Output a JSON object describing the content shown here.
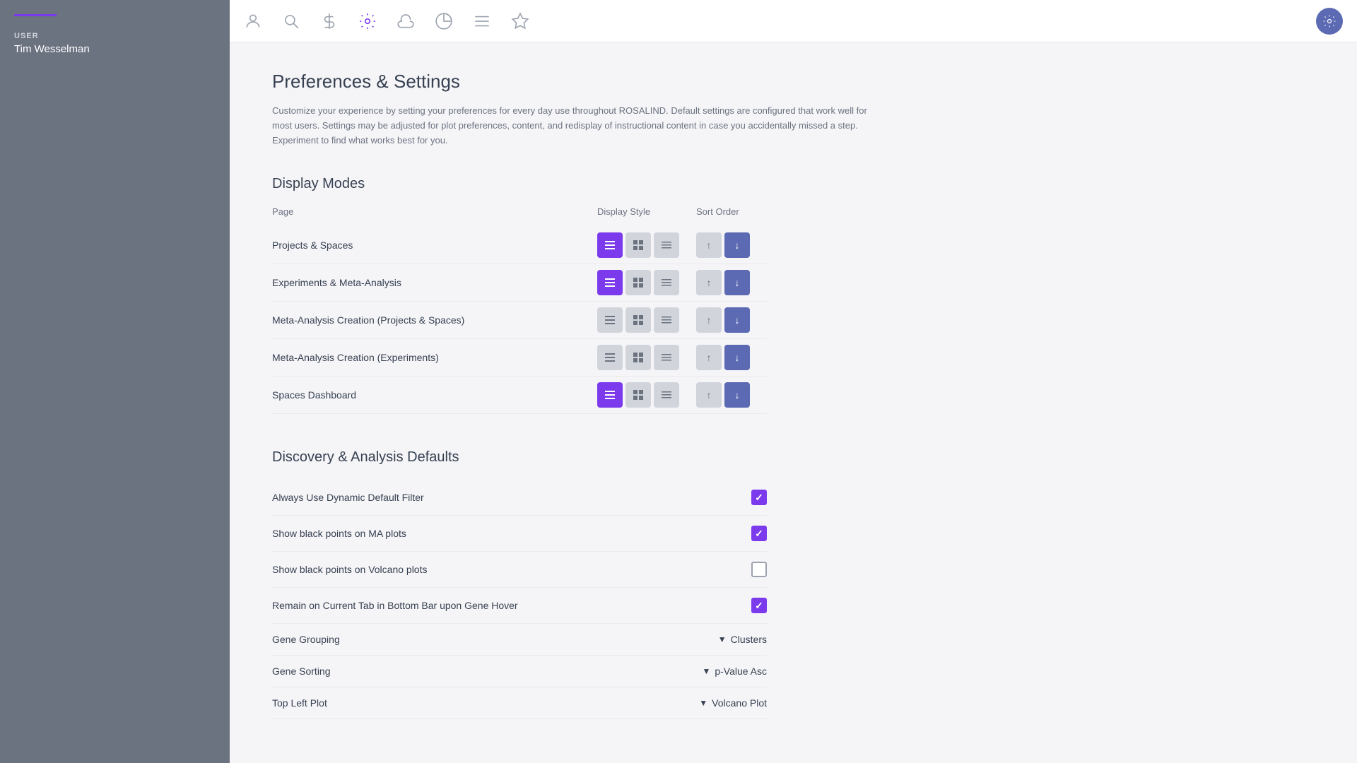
{
  "sidebar": {
    "user_label": "USER",
    "user_name": "Tim Wesselman"
  },
  "topbar": {
    "icons": [
      {
        "name": "person-icon",
        "symbol": "person",
        "active": false
      },
      {
        "name": "search-icon",
        "symbol": "search",
        "active": false
      },
      {
        "name": "dollar-icon",
        "symbol": "dollar",
        "active": false
      },
      {
        "name": "gear-icon",
        "symbol": "gear",
        "active": true
      },
      {
        "name": "cloud-icon",
        "symbol": "cloud",
        "active": false
      },
      {
        "name": "chart-icon",
        "symbol": "chart",
        "active": false
      },
      {
        "name": "list-icon",
        "symbol": "list",
        "active": false
      },
      {
        "name": "star-icon",
        "symbol": "star",
        "active": false
      }
    ]
  },
  "page": {
    "title": "Preferences & Settings",
    "description": "Customize your experience by setting your preferences for every day use throughout ROSALIND. Default settings are configured that work well for most users. Settings may be adjusted for plot preferences, content, and redisplay of instructional content in case you accidentally missed a step. Experiment to find what works best for you."
  },
  "display_modes": {
    "section_title": "Display Modes",
    "header_page": "Page",
    "header_display_style": "Display Style",
    "header_sort_order": "Sort Order",
    "rows": [
      {
        "label": "Projects & Spaces",
        "active_style": 0
      },
      {
        "label": "Experiments & Meta-Analysis",
        "active_style": 0
      },
      {
        "label": "Meta-Analysis Creation (Projects & Spaces)",
        "active_style": null
      },
      {
        "label": "Meta-Analysis Creation (Experiments)",
        "active_style": null
      },
      {
        "label": "Spaces Dashboard",
        "active_style": 0
      }
    ]
  },
  "defaults": {
    "section_title": "Discovery & Analysis Defaults",
    "rows": [
      {
        "label": "Always Use Dynamic Default Filter",
        "type": "checkbox",
        "checked": true
      },
      {
        "label": "Show black points on MA plots",
        "type": "checkbox",
        "checked": true
      },
      {
        "label": "Show black points on Volcano plots",
        "type": "checkbox",
        "checked": false
      },
      {
        "label": "Remain on Current Tab in Bottom Bar upon Gene Hover",
        "type": "checkbox",
        "checked": true
      },
      {
        "label": "Gene Grouping",
        "type": "dropdown",
        "value": "Clusters"
      },
      {
        "label": "Gene Sorting",
        "type": "dropdown",
        "value": "p-Value Asc"
      },
      {
        "label": "Top Left Plot",
        "type": "dropdown",
        "value": "Volcano Plot"
      }
    ]
  }
}
